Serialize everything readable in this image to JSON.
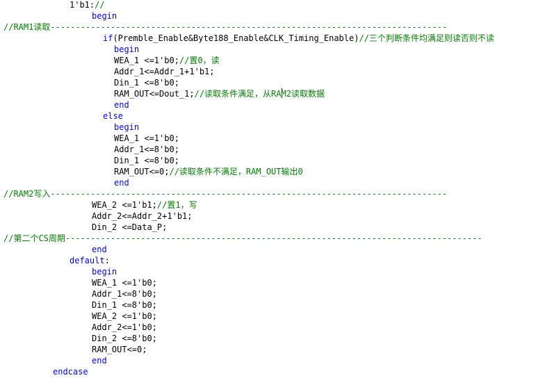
{
  "colors": {
    "background": "#ffffff",
    "keyword": "#0000ff",
    "comment": "#008000",
    "text": "#000000"
  },
  "code_lines": [
    [
      {
        "t": "1'b1:",
        "c": "tx"
      },
      {
        "t": "//",
        "c": "cm"
      }
    ],
    [
      {
        "t": "begin",
        "c": "kw"
      }
    ],
    [
      {
        "t": "//RAM1读取-------------------------------------------------------------------------------",
        "c": "cm"
      }
    ],
    [
      {
        "t": "if",
        "c": "kw"
      },
      {
        "t": "(Premble_Enable&Byte188_Enable&CLK_Timing_Enable)",
        "c": "tx"
      },
      {
        "t": "//三个判断条件均满足则读否则不读",
        "c": "cm"
      }
    ],
    [
      {
        "t": "begin",
        "c": "kw"
      }
    ],
    [
      {
        "t": "WEA_1 <=1'b0;",
        "c": "tx"
      },
      {
        "t": "//置0，读",
        "c": "cm"
      }
    ],
    [
      {
        "t": "Addr_1<=Addr_1+1'b1;",
        "c": "tx"
      }
    ],
    [
      {
        "t": "Din_1 <=8'b0;",
        "c": "tx"
      }
    ],
    [
      {
        "t": "RAM_OUT<=Dout_1;",
        "c": "tx"
      },
      {
        "t": "//读取条件满足，从RAM2读取数据",
        "c": "cm"
      }
    ],
    [
      {
        "t": "end",
        "c": "kw"
      }
    ],
    [
      {
        "t": "else",
        "c": "kw"
      }
    ],
    [
      {
        "t": "begin",
        "c": "kw"
      }
    ],
    [
      {
        "t": "WEA_1 <=1'b0;",
        "c": "tx"
      }
    ],
    [
      {
        "t": "Addr_1<=8'b0;",
        "c": "tx"
      }
    ],
    [
      {
        "t": "Din_1 <=8'b0;",
        "c": "tx"
      }
    ],
    [
      {
        "t": "RAM_OUT<=0;",
        "c": "tx"
      },
      {
        "t": "//读取条件不满足，RAM_OUT输出0",
        "c": "cm"
      }
    ],
    [
      {
        "t": "end",
        "c": "kw"
      }
    ],
    [
      {
        "t": "//RAM2写入-------------------------------------------------------------------------------",
        "c": "cm"
      }
    ],
    [
      {
        "t": "WEA_2 <=1'b1;",
        "c": "tx"
      },
      {
        "t": "//置1，写",
        "c": "cm"
      }
    ],
    [
      {
        "t": "Addr_2<=Addr_2+1'b1;",
        "c": "tx"
      }
    ],
    [
      {
        "t": "Din_2 <=Data_P;",
        "c": "tx"
      }
    ],
    [
      {
        "t": "//第二个CS周期-----------------------------------------------------------------------------------",
        "c": "cm"
      }
    ],
    [
      {
        "t": "end",
        "c": "kw"
      }
    ],
    [
      {
        "t": "default",
        "c": "kw"
      },
      {
        "t": ":",
        "c": "tx"
      }
    ],
    [
      {
        "t": "begin",
        "c": "kw"
      }
    ],
    [
      {
        "t": "WEA_1 <=1'b0;",
        "c": "tx"
      }
    ],
    [
      {
        "t": "Addr_1<=8'b0;",
        "c": "tx"
      }
    ],
    [
      {
        "t": "Din_1 <=8'b0;",
        "c": "tx"
      }
    ],
    [
      {
        "t": "WEA_2 <=1'b0;",
        "c": "tx"
      }
    ],
    [
      {
        "t": "Addr_2<=1'b0;",
        "c": "tx"
      }
    ],
    [
      {
        "t": "Din_2 <=8'b0;",
        "c": "tx"
      }
    ],
    [
      {
        "t": "RAM_OUT<=0;",
        "c": "tx"
      }
    ],
    [
      {
        "t": "end",
        "c": "kw"
      }
    ],
    [
      {
        "t": "endcase",
        "c": "kw"
      }
    ]
  ]
}
